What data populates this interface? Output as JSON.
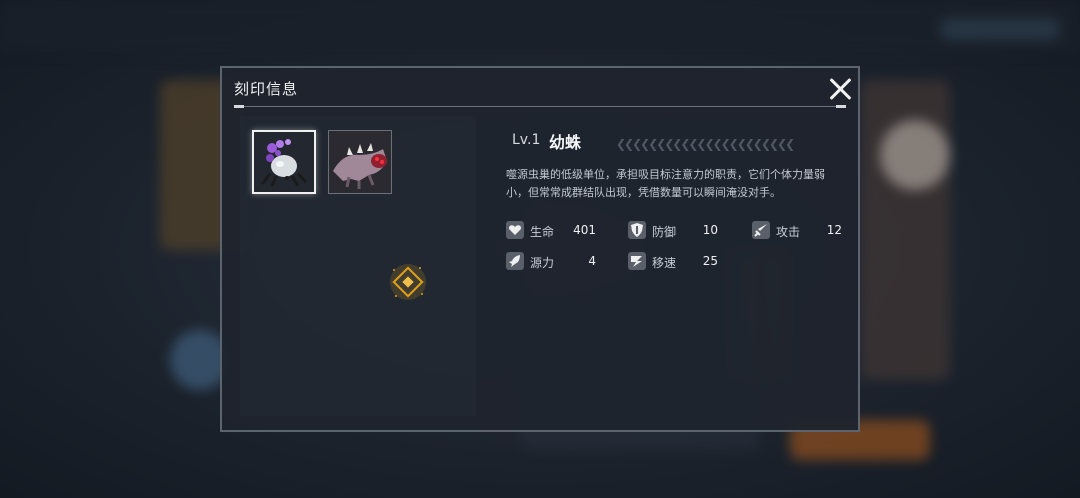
{
  "dialog": {
    "title": "刻印信息",
    "close_icon": "close-icon"
  },
  "slots": [
    {
      "name": "spiderling-portrait",
      "selected": true
    },
    {
      "name": "beast-portrait",
      "selected": false
    }
  ],
  "rune_icon": "rune-diamond-icon",
  "unit": {
    "level_label": "Lv.1",
    "name": "幼蛛",
    "description": "噬源虫巢的低级单位，承担吸目标注意力的职责，它们个体力量弱小，但常常成群结队出现，凭借数量可以瞬间淹没对手。",
    "chevrons": "❮❮❮❮❮❮❮❮❮❮❮❮❮❮❮❮❮❮❮❮❮❮"
  },
  "stats": [
    {
      "icon": "heart-icon",
      "label": "生命",
      "value": "401"
    },
    {
      "icon": "shield-icon",
      "label": "防御",
      "value": "10"
    },
    {
      "icon": "sword-icon",
      "label": "攻击",
      "value": "12"
    },
    {
      "icon": "source-power-icon",
      "label": "源力",
      "value": "4"
    },
    {
      "icon": "move-speed-icon",
      "label": "移速",
      "value": "25"
    }
  ],
  "colors": {
    "accent_gold": "#e0a21a",
    "panel_bg": "#1e242d",
    "border": "#5c6470"
  }
}
